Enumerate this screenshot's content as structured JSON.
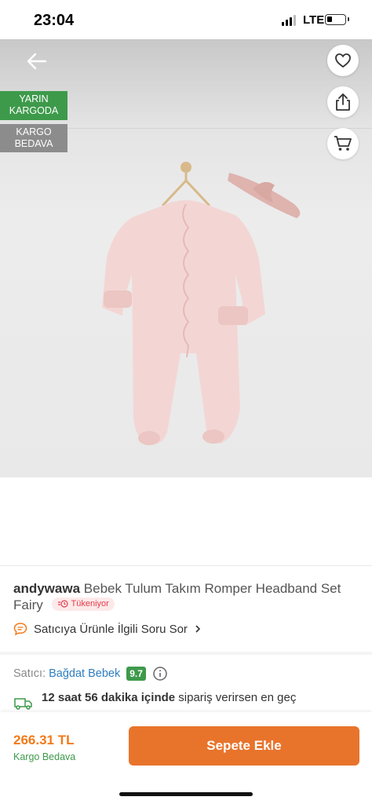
{
  "status_bar": {
    "time": "23:04",
    "network": "LTE",
    "battery_level": 0.3
  },
  "badges": {
    "next_day_line1": "YARIN",
    "next_day_line2": "KARGODA",
    "free_ship_line1": "KARGO",
    "free_ship_line2": "BEDAVA"
  },
  "product": {
    "brand": "andywawa",
    "name": "Bebek Tulum Takım Romper Headband Set Fairy",
    "stock_label": "Tükeniyor"
  },
  "qa": {
    "label": "Satıcıya Ürünle İlgili Soru Sor"
  },
  "seller": {
    "label": "Satıcı:",
    "name": "Bağdat Bebek",
    "score": "9.7"
  },
  "delivery": {
    "bold": "12 saat 56 dakika içinde",
    "rest": "sipariş verirsen en geç"
  },
  "bottom": {
    "price": "266.31 TL",
    "shipping": "Kargo Bedava",
    "add_to_cart": "Sepete Ekle"
  },
  "colors": {
    "accent": "#f27a1a",
    "button": "#e8742c",
    "green": "#3e9a4b",
    "link": "#2f7ec0",
    "warning": "#e53d4c"
  }
}
